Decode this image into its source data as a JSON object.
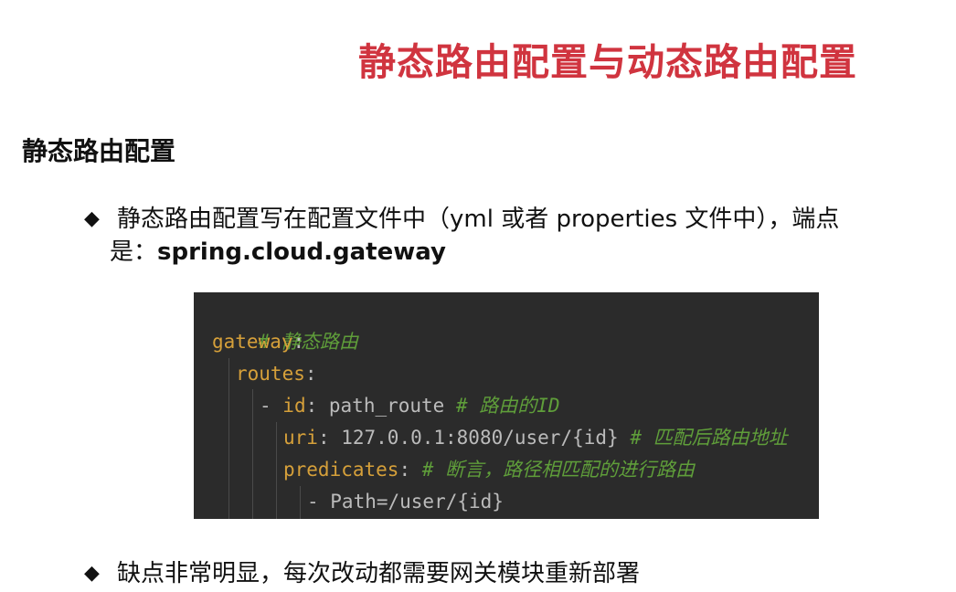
{
  "title": "静态路由配置与动态路由配置",
  "section_heading": "静态路由配置",
  "bullet1": {
    "marker": "◆",
    "text": "静态路由配置写在配置文件中（yml 或者 properties 文件中），端点",
    "cont_prefix": "是：",
    "endpoint": "spring.cloud.gateway"
  },
  "code": {
    "comment1": "# 静态路由",
    "gateway_key": "gateway",
    "colon": ":",
    "routes_key": "routes",
    "dash": "- ",
    "id_key": "id",
    "id_value": " path_route ",
    "id_comment": "# 路由的ID",
    "uri_key": "uri",
    "uri_value": " 127.0.0.1:8080/user/{id} ",
    "uri_comment": "# 匹配后路由地址",
    "predicates_key": "predicates",
    "predicates_comment": " # 断言，路径相匹配的进行路由",
    "path_item": "- Path=/user/{id}"
  },
  "bullet2": {
    "marker": "◆",
    "text": "缺点非常明显，每次改动都需要网关模块重新部署"
  }
}
